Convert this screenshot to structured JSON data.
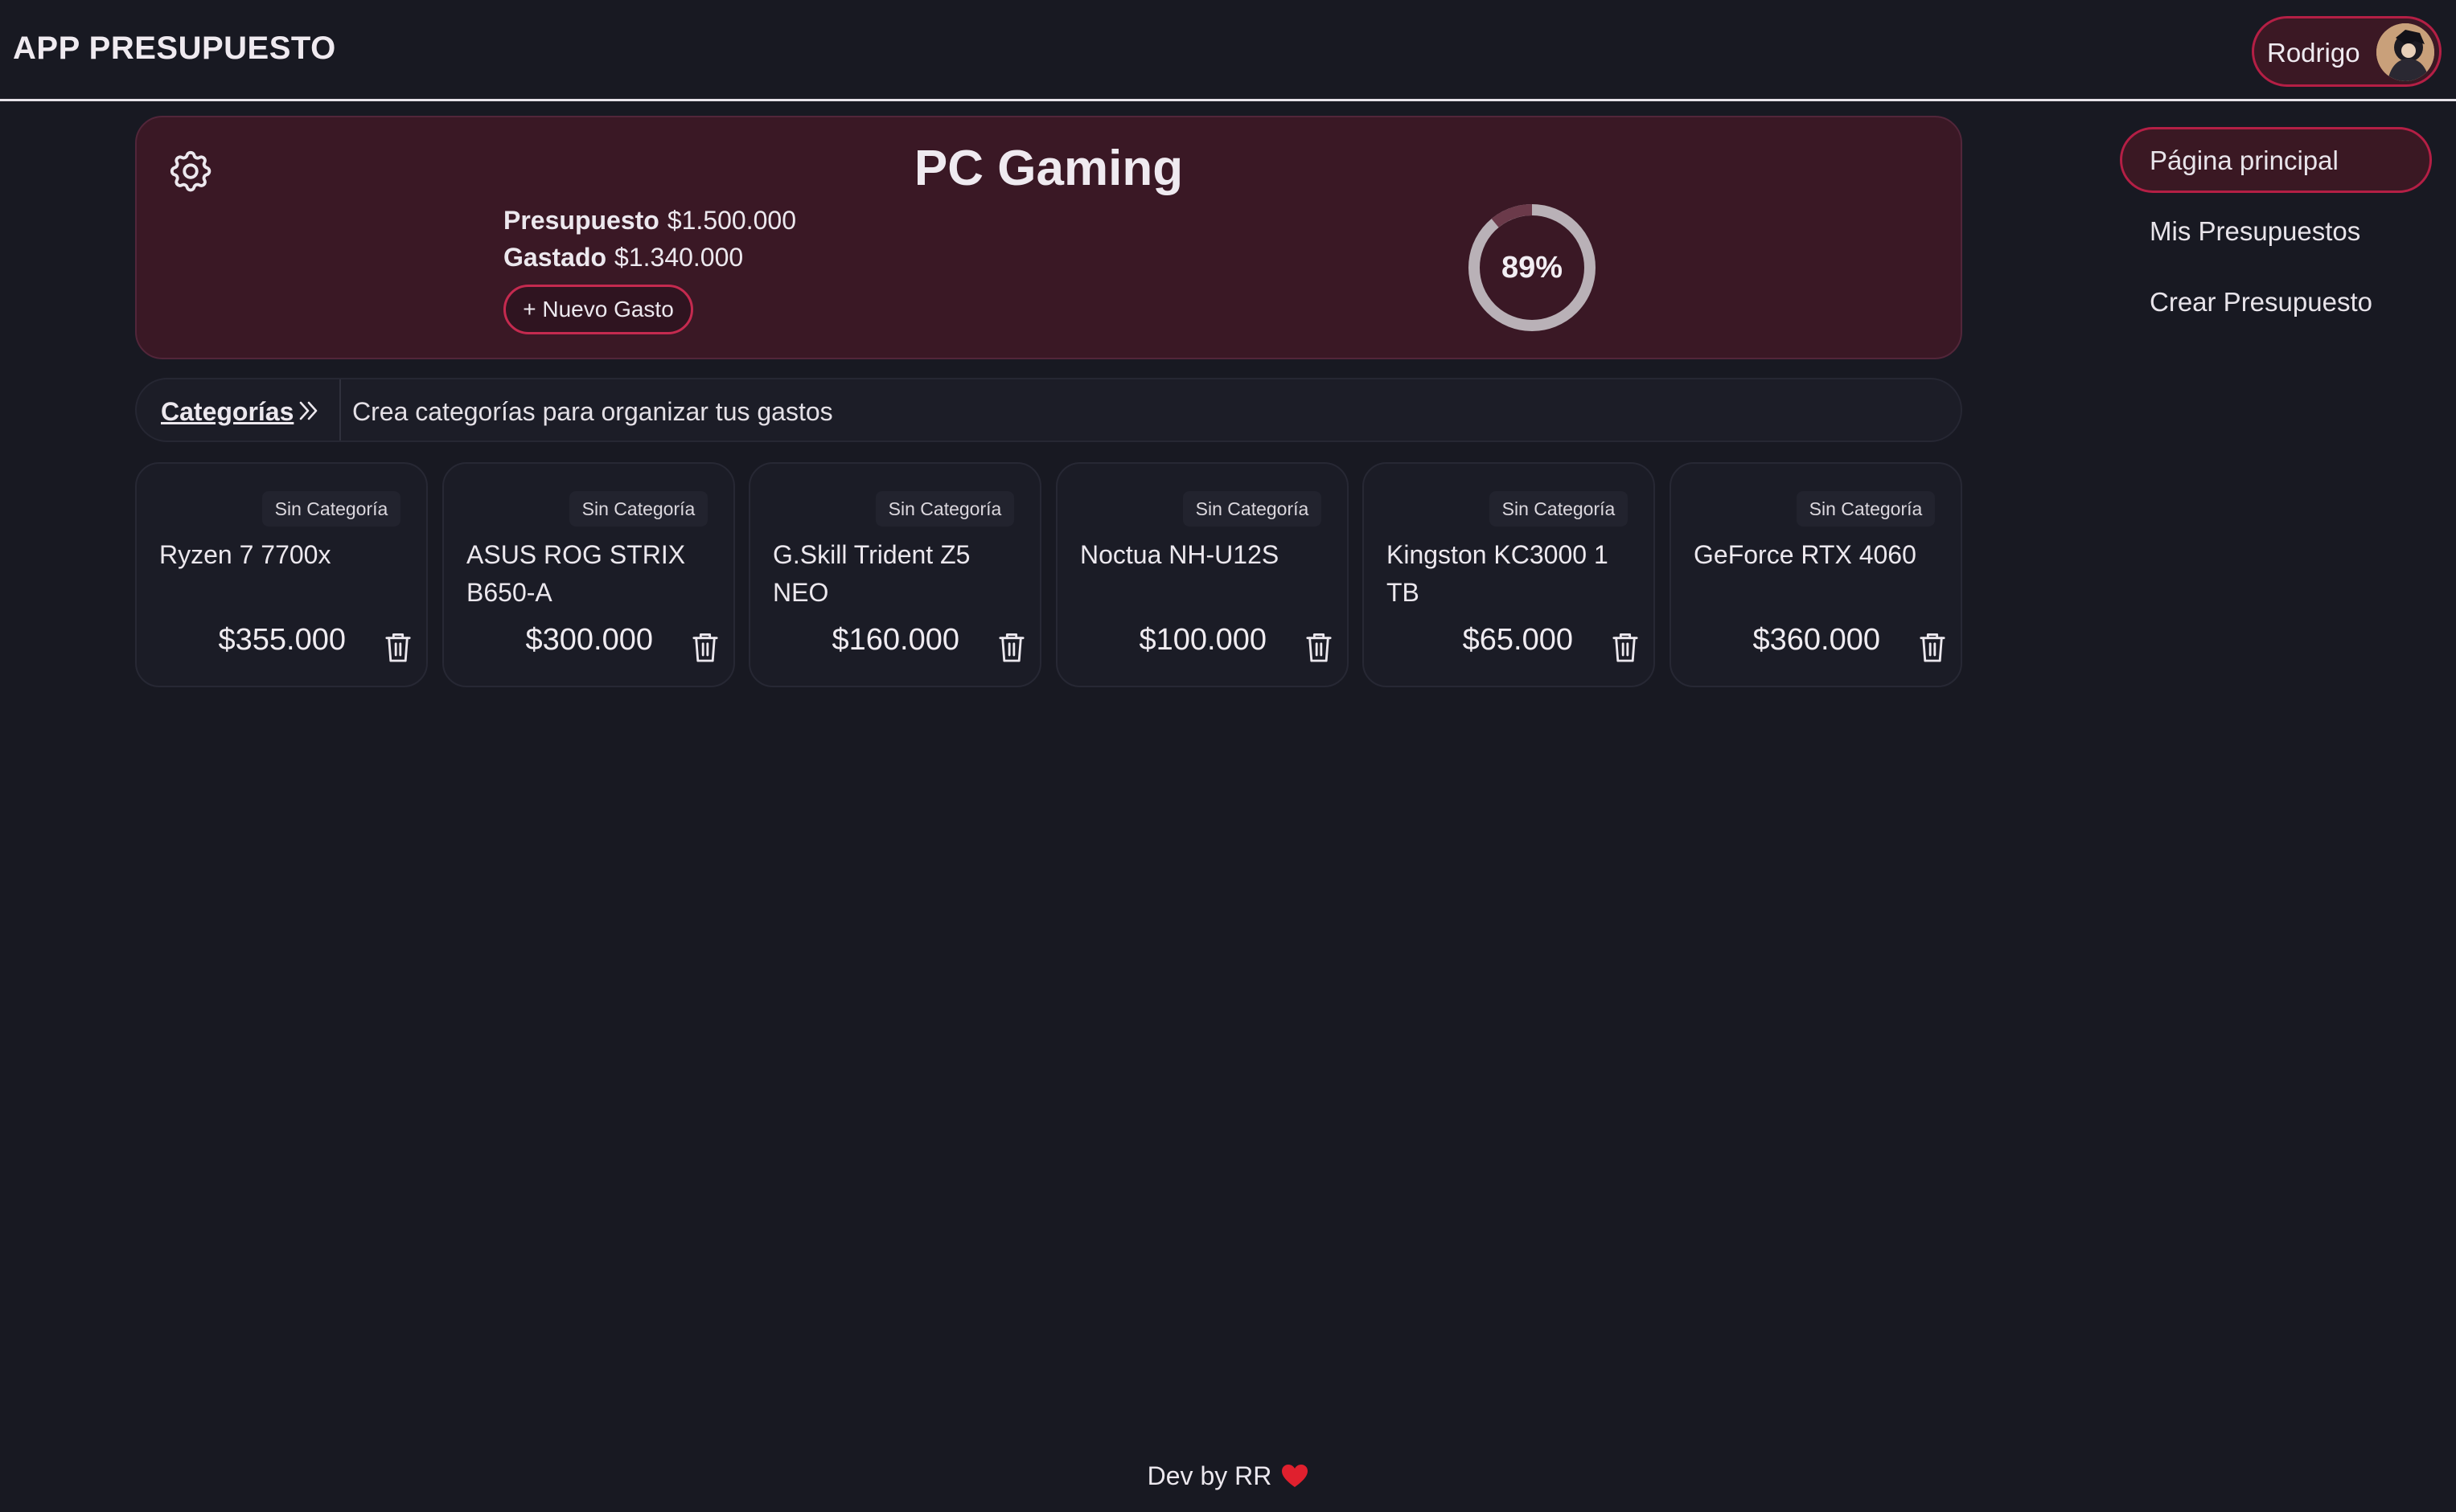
{
  "app": {
    "title": "APP PRESUPUESTO"
  },
  "user": {
    "name": "Rodrigo",
    "avatar_icon": "user-avatar"
  },
  "nav": {
    "items": [
      {
        "label": "Página principal",
        "active": true
      },
      {
        "label": "Mis Presupuestos",
        "active": false
      },
      {
        "label": "Crear Presupuesto",
        "active": false
      }
    ]
  },
  "budget": {
    "title": "PC Gaming",
    "budget_label": "Presupuesto",
    "budget_value": "$1.500.000",
    "spent_label": "Gastado",
    "spent_value": "$1.340.000",
    "new_expense_label": "+ Nuevo Gasto",
    "percent_label": "89%",
    "percent_value": 0.89,
    "settings_icon": "gear-icon"
  },
  "categories": {
    "link_label": "Categorías",
    "hint": "Crea categorías para organizar tus gastos",
    "chevron_icon": "chevrons-right-icon"
  },
  "expenses": [
    {
      "name": "Ryzen 7 7700x",
      "amount": "$355.000",
      "category": "Sin Categoría"
    },
    {
      "name": "ASUS ROG STRIX B650-A",
      "amount": "$300.000",
      "category": "Sin Categoría"
    },
    {
      "name": "G.Skill Trident Z5 NEO",
      "amount": "$160.000",
      "category": "Sin Categoría"
    },
    {
      "name": "Noctua NH-U12S",
      "amount": "$100.000",
      "category": "Sin Categoría"
    },
    {
      "name": "Kingston KC3000 1 TB",
      "amount": "$65.000",
      "category": "Sin Categoría"
    },
    {
      "name": "GeForce RTX 4060",
      "amount": "$360.000",
      "category": "Sin Categoría"
    }
  ],
  "footer": {
    "text": "Dev by RR",
    "icon": "heart-icon"
  },
  "colors": {
    "background": "#181922",
    "accent": "#b41f45",
    "card": "#3a1825",
    "gauge_track": "#b9b1b7",
    "gauge_fill": "#6b3a4a",
    "heart": "#e0202e"
  }
}
